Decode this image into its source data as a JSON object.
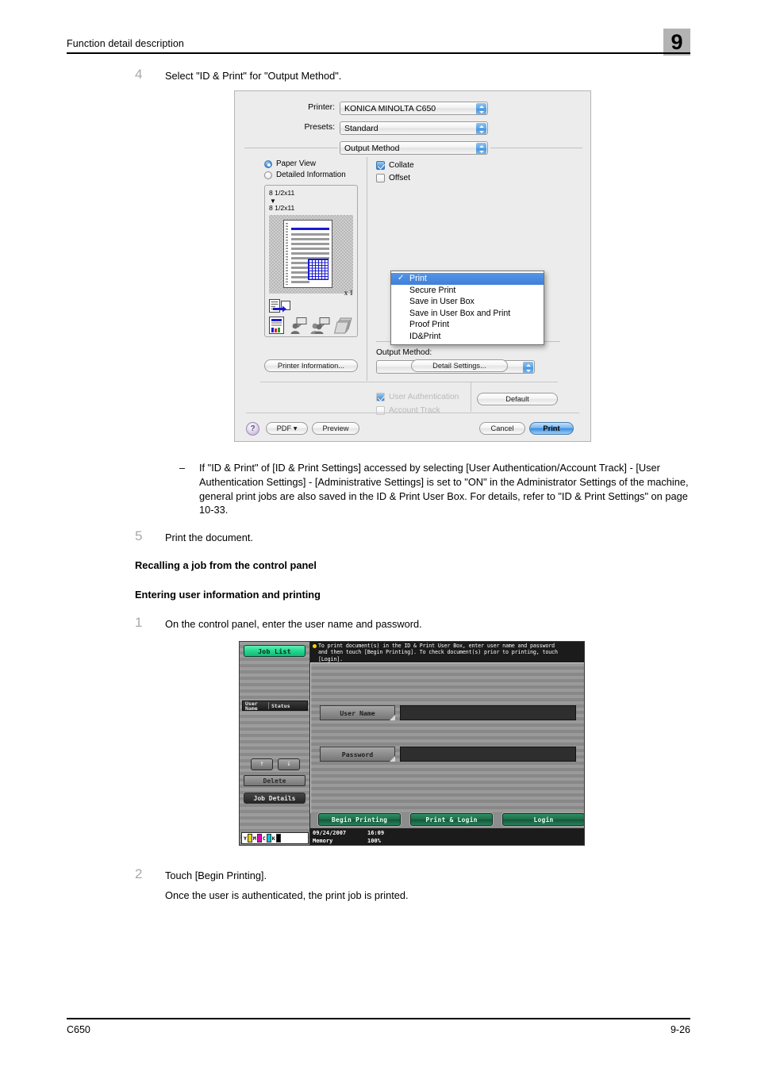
{
  "header": {
    "title": "Function detail description",
    "chapter": "9"
  },
  "footer": {
    "model": "C650",
    "page": "9-26"
  },
  "steps": {
    "step4_num": "4",
    "step4_text": "Select \"ID & Print\" for \"Output Method\".",
    "note_dash": "–",
    "note_text": "If \"ID & Print\" of [ID & Print Settings] accessed by selecting [User Authentication/Account Track] - [User Authentication Settings] - [Administrative Settings] is set to \"ON\" in the Administrator Settings of the machine, general print jobs are also saved in the ID & Print User Box. For details, refer to \"ID & Print Settings\" on page 10-33.",
    "step5_num": "5",
    "step5_text": "Print the document.",
    "subhead1": "Recalling a job from the control panel",
    "subhead2": "Entering user information and printing",
    "step1_num": "1",
    "step1_text": "On the control panel, enter the user name and password.",
    "step2_num": "2",
    "step2_text": "Touch [Begin Printing].",
    "step2_sub": "Once the user is authenticated, the print job is printed."
  },
  "print_dialog": {
    "printer_label": "Printer:",
    "printer_value": "KONICA MINOLTA C650",
    "presets_label": "Presets:",
    "presets_value": "Standard",
    "pane_value": "Output Method",
    "view_radios": [
      {
        "label": "Paper View",
        "selected": true
      },
      {
        "label": "Detailed Information",
        "selected": false
      }
    ],
    "paper_size_top": "8 1/2x11",
    "paper_size_caret": "▼",
    "paper_size_bottom": "8 1/2x11",
    "copies": "x 1",
    "printer_information_button": "Printer Information...",
    "checkboxes": [
      {
        "label": "Collate",
        "checked": true
      },
      {
        "label": "Offset",
        "checked": false
      }
    ],
    "output_method_label": "Output Method:",
    "ghost_checkboxes": [
      {
        "label": "User Authentication",
        "checked": true
      },
      {
        "label": "Account Track",
        "checked": false
      }
    ],
    "menu_items": [
      {
        "label": "Print",
        "checked": true,
        "selected": true
      },
      {
        "label": "Secure Print",
        "checked": false,
        "selected": false
      },
      {
        "label": "Save in User Box",
        "checked": false,
        "selected": false
      },
      {
        "label": "Save in User Box and Print",
        "checked": false,
        "selected": false
      },
      {
        "label": "Proof Print",
        "checked": false,
        "selected": false
      },
      {
        "label": "ID&Print",
        "checked": false,
        "selected": false
      }
    ],
    "menu_check_glyph": "✓",
    "detail_settings_button": "Detail Settings...",
    "default_button": "Default",
    "help_glyph": "?",
    "pdf_button": "PDF ▾",
    "preview_button": "Preview",
    "cancel_button": "Cancel",
    "print_button": "Print"
  },
  "control_panel": {
    "job_list_button": "Job List",
    "column_header_name_line1": "User",
    "column_header_name_line2": "Name",
    "column_header_status": "Status",
    "arrow_up": "↑",
    "arrow_down": "↓",
    "delete_button": "Delete",
    "job_details_button": "Job Details",
    "toner": [
      {
        "label": "Y",
        "color": "#e8d400"
      },
      {
        "label": "M",
        "color": "#e200b9"
      },
      {
        "label": "C",
        "color": "#00c6d8"
      },
      {
        "label": "K",
        "color": "#000000"
      }
    ],
    "message_line1": "To print document(s) in the ID & Print User Box, enter user name and password",
    "message_line2": "and then touch [Begin Printing]. To check document(s) prior to printing, touch",
    "message_line3": "[Login].",
    "fields": [
      {
        "key": "User Name",
        "value": ""
      },
      {
        "key": "Password",
        "value": ""
      }
    ],
    "buttons": [
      {
        "label": "Begin Printing"
      },
      {
        "label": "Print & Login"
      },
      {
        "label": "Login"
      }
    ],
    "status_date": "09/24/2007",
    "status_time": "16:09",
    "status_memory_label": "Memory",
    "status_memory_value": "100%"
  }
}
